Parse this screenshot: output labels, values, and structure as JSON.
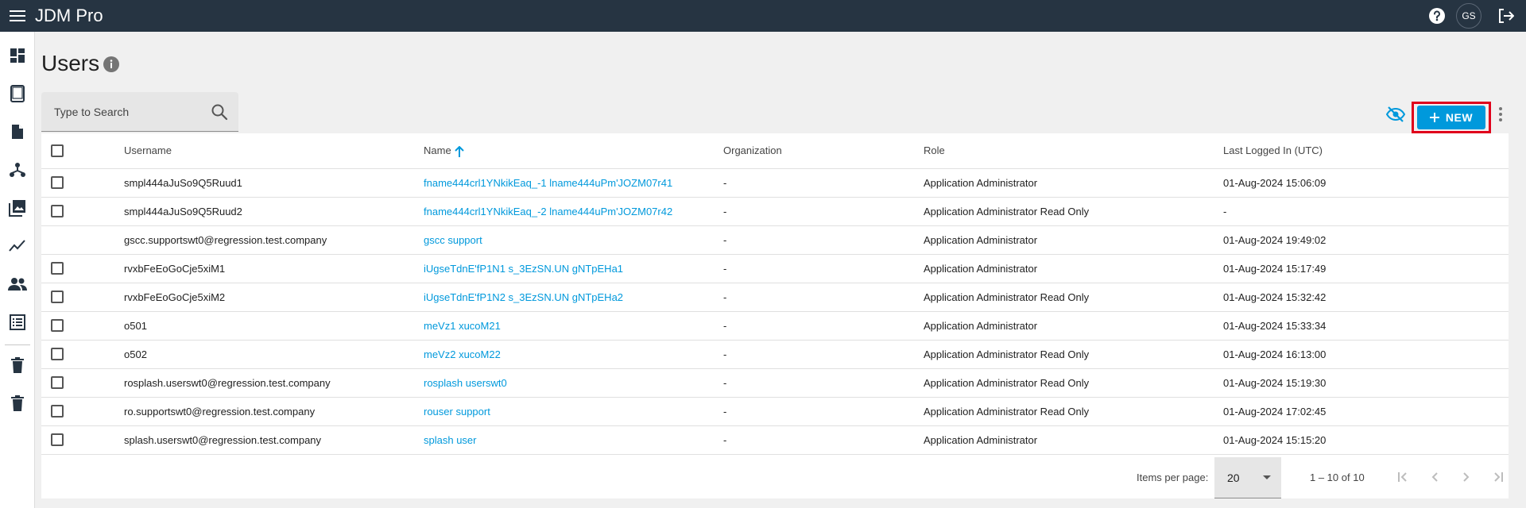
{
  "app": {
    "title": "JDM Pro"
  },
  "header": {
    "avatar_initials": "GS",
    "icons": [
      "menu-icon",
      "help-icon",
      "logout-icon"
    ]
  },
  "sidenav": {
    "icons": [
      "dashboard-icon",
      "tablet-icon",
      "document-icon",
      "hierarchy-icon",
      "photo-library-icon",
      "trending-icon",
      "people-icon",
      "list-icon",
      "trash-icon",
      "trash-icon"
    ]
  },
  "page": {
    "title": "Users"
  },
  "search": {
    "placeholder": "Type to Search"
  },
  "toolbar": {
    "new_label": "NEW"
  },
  "table": {
    "columns": [
      "Username",
      "Name",
      "Organization",
      "Role",
      "Last Logged In (UTC)"
    ],
    "rows": [
      {
        "username": "smpl444aJuSo9Q5Ruud1",
        "name": "fname444crl1YNkikEaq_-1 lname444uPm'JOZM07r41",
        "organization": "-",
        "role": "Application Administrator",
        "last_logged_in": "01-Aug-2024 15:06:09",
        "has_checkbox": true
      },
      {
        "username": "smpl444aJuSo9Q5Ruud2",
        "name": "fname444crl1YNkikEaq_-2 lname444uPm'JOZM07r42",
        "organization": "-",
        "role": "Application Administrator Read Only",
        "last_logged_in": "-",
        "has_checkbox": true
      },
      {
        "username": "gscc.supportswt0@regression.test.company",
        "name": "gscc support",
        "organization": "-",
        "role": "Application Administrator",
        "last_logged_in": "01-Aug-2024 19:49:02",
        "has_checkbox": false
      },
      {
        "username": "rvxbFeEoGoCje5xiM1",
        "name": "iUgseTdnE'fP1N1 s_3EzSN.UN gNTpEHa1",
        "organization": "-",
        "role": "Application Administrator",
        "last_logged_in": "01-Aug-2024 15:17:49",
        "has_checkbox": true
      },
      {
        "username": "rvxbFeEoGoCje5xiM2",
        "name": "iUgseTdnE'fP1N2 s_3EzSN.UN gNTpEHa2",
        "organization": "-",
        "role": "Application Administrator Read Only",
        "last_logged_in": "01-Aug-2024 15:32:42",
        "has_checkbox": true
      },
      {
        "username": "o501",
        "name": "meVz1 xucoM21",
        "organization": "-",
        "role": "Application Administrator",
        "last_logged_in": "01-Aug-2024 15:33:34",
        "has_checkbox": true
      },
      {
        "username": "o502",
        "name": "meVz2 xucoM22",
        "organization": "-",
        "role": "Application Administrator Read Only",
        "last_logged_in": "01-Aug-2024 16:13:00",
        "has_checkbox": true
      },
      {
        "username": "rosplash.userswt0@regression.test.company",
        "name": "rosplash userswt0",
        "organization": "-",
        "role": "Application Administrator Read Only",
        "last_logged_in": "01-Aug-2024 15:19:30",
        "has_checkbox": true
      },
      {
        "username": "ro.supportswt0@regression.test.company",
        "name": "rouser support",
        "organization": "-",
        "role": "Application Administrator Read Only",
        "last_logged_in": "01-Aug-2024 17:02:45",
        "has_checkbox": true
      },
      {
        "username": "splash.userswt0@regression.test.company",
        "name": "splash user",
        "organization": "-",
        "role": "Application Administrator",
        "last_logged_in": "01-Aug-2024 15:15:20",
        "has_checkbox": true
      }
    ]
  },
  "paginator": {
    "items_per_page_label": "Items per page:",
    "items_per_page_value": "20",
    "range_label": "1 – 10 of 10"
  },
  "colors": {
    "topbar": "#263442",
    "accent": "#0099dc",
    "highlight": "#e0001b"
  }
}
